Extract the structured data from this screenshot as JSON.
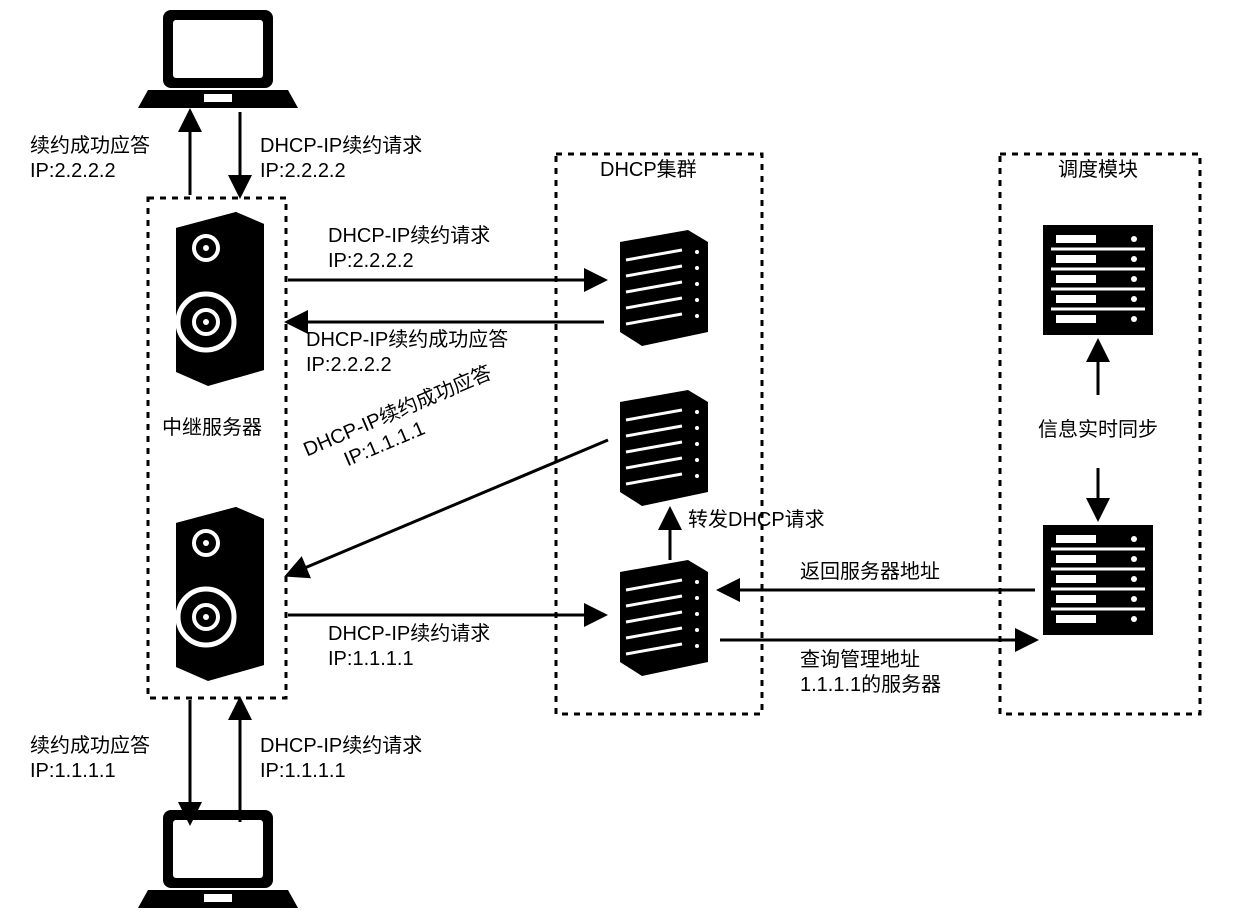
{
  "labels": {
    "dhcp_cluster": "DHCP集群",
    "scheduler": "调度模块",
    "relay_server": "中继服务器",
    "sync": "信息实时同步",
    "forward_req": "转发DHCP请求",
    "return_addr": "返回服务器地址",
    "query_mgmt_line1": "查询管理地址",
    "query_mgmt_line2": "1.1.1.1的服务器",
    "req_top_client_line1": "DHCP-IP续约请求",
    "req_top_client_line2": "IP:2.2.2.2",
    "resp_top_client_line1": "续约成功应答",
    "resp_top_client_line2": "IP:2.2.2.2",
    "req_mid_up_line1": "DHCP-IP续约请求",
    "req_mid_up_line2": "IP:2.2.2.2",
    "resp_mid_up_line1": "DHCP-IP续约成功应答",
    "resp_mid_up_line2": "IP:2.2.2.2",
    "resp_mid_diag_line1": "DHCP-IP续约成功应答",
    "resp_mid_diag_line2": "IP:1.1.1.1",
    "req_low_line1": "DHCP-IP续约请求",
    "req_low_line2": "IP:1.1.1.1",
    "resp_bot_client_line1": "续约成功应答",
    "resp_bot_client_line2": "IP:1.1.1.1",
    "req_bot_client_line1": "DHCP-IP续约请求",
    "req_bot_client_line2": "IP:1.1.1.1"
  }
}
